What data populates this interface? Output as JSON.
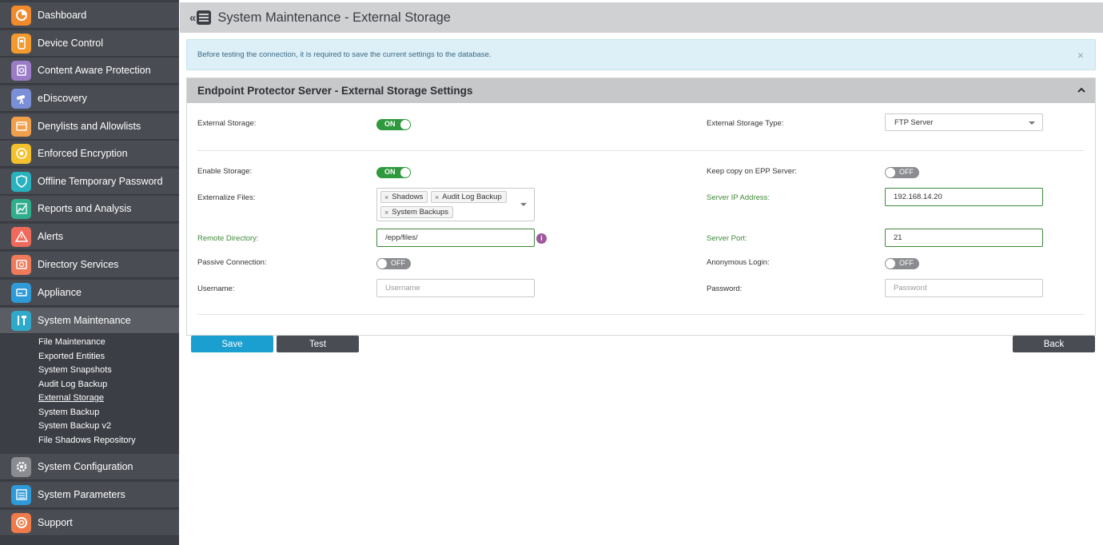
{
  "sidebar": {
    "items": [
      {
        "label": "Dashboard",
        "icon": "dashboard-icon",
        "color": "#f08a2c"
      },
      {
        "label": "Device Control",
        "icon": "usb-device-icon",
        "color": "#f29a2e"
      },
      {
        "label": "Content Aware Protection",
        "icon": "content-aware-icon",
        "color": "#9a7cc8"
      },
      {
        "label": "eDiscovery",
        "icon": "telescope-icon",
        "color": "#7a8fd8"
      },
      {
        "label": "Denylists and Allowlists",
        "icon": "list-browser-icon",
        "color": "#f0a04a"
      },
      {
        "label": "Enforced Encryption",
        "icon": "encryption-icon",
        "color": "#f3c12e"
      },
      {
        "label": "Offline Temporary Password",
        "icon": "shield-icon",
        "color": "#28b3bf"
      },
      {
        "label": "Reports and Analysis",
        "icon": "chart-icon",
        "color": "#2fae8e"
      },
      {
        "label": "Alerts",
        "icon": "alert-icon",
        "color": "#ef6a5a"
      },
      {
        "label": "Directory Services",
        "icon": "directory-icon",
        "color": "#ee7a5a"
      },
      {
        "label": "Appliance",
        "icon": "appliance-icon",
        "color": "#2f9ad8"
      },
      {
        "label": "System Maintenance",
        "icon": "tools-icon",
        "color": "#2ea9c9"
      },
      {
        "label": "System Configuration",
        "icon": "gear-icon",
        "color": "#8a8c92"
      },
      {
        "label": "System Parameters",
        "icon": "parameters-icon",
        "color": "#2f9ad8"
      },
      {
        "label": "Support",
        "icon": "lifebuoy-icon",
        "color": "#ef7a4a"
      }
    ],
    "submenu": [
      "File Maintenance",
      "Exported Entities",
      "System Snapshots",
      "Audit Log Backup",
      "External Storage",
      "System Backup",
      "System Backup v2",
      "File Shadows Repository"
    ]
  },
  "header": {
    "collapse_symbol": "«",
    "title": "System Maintenance - External Storage"
  },
  "alert": {
    "text": "Before testing the connection, it is required to save the current settings to the database.",
    "close_symbol": "×"
  },
  "panel": {
    "title": "Endpoint Protector Server - External Storage Settings",
    "external_storage": {
      "label": "External Storage:",
      "state": "ON"
    },
    "external_storage_type": {
      "label": "External Storage Type:",
      "value": "FTP Server"
    },
    "enable_storage": {
      "label": "Enable Storage:",
      "state": "ON"
    },
    "keep_copy": {
      "label": "Keep copy on EPP Server:",
      "state": "OFF"
    },
    "externalize_files": {
      "label": "Externalize Files:",
      "chips": [
        "Shadows",
        "Audit Log Backup",
        "System Backups"
      ],
      "remove_symbol": "×"
    },
    "server_ip": {
      "label": "Server IP Address:",
      "value": "192.168.14.20"
    },
    "remote_directory": {
      "label": "Remote Directory:",
      "value": "/epp/files/",
      "info_symbol": "i"
    },
    "server_port": {
      "label": "Server Port:",
      "value": "21"
    },
    "passive_connection": {
      "label": "Passive Connection:",
      "state": "OFF"
    },
    "anonymous_login": {
      "label": "Anonymous Login:",
      "state": "OFF"
    },
    "username": {
      "label": "Username:",
      "value": "",
      "placeholder": "Username"
    },
    "password": {
      "label": "Password:",
      "value": "",
      "placeholder": "Password"
    }
  },
  "buttons": {
    "save": "Save",
    "test": "Test",
    "back": "Back"
  },
  "colors": {
    "accent_blue": "#1a9fd0",
    "toggle_on": "#2e9a3d",
    "toggle_off": "#8a8c90",
    "valid_green": "#3f8a3a",
    "sidebar_bg": "#3c3e45"
  }
}
